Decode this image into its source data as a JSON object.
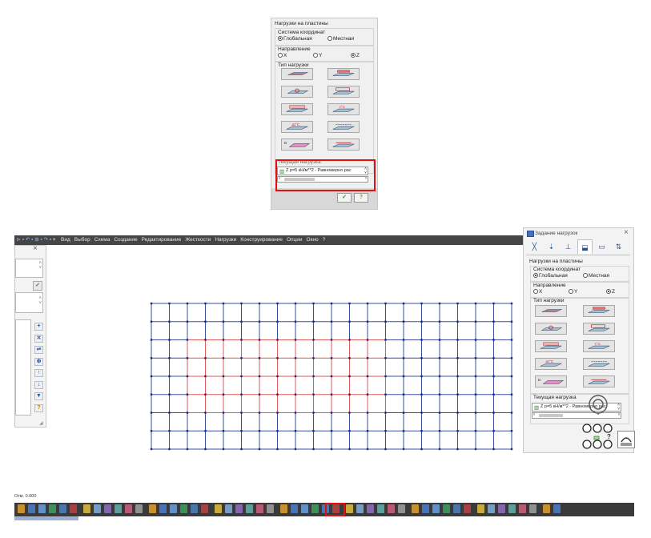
{
  "top_dialog": {
    "group_title": "Нагрузки на пластины",
    "coord_label": "Система координат",
    "coord_global": "Глобальная",
    "coord_local": "Местная",
    "direction_label": "Направление",
    "dir_x": "X",
    "dir_y": "Y",
    "dir_z": "Z",
    "load_type_label": "Тип нагрузки",
    "current_load_label": "Текущая нагрузка",
    "current_load_value": "Z p=5 кН/м**2 - Равномерно рас",
    "apply_label": "✓",
    "help_label": "?"
  },
  "menu": {
    "quick_access": "⊳ ▪ ↶ ▪ ⊞ ▪ ↷ ▪ ▾",
    "items": [
      "Вид",
      "Выбор",
      "Схема",
      "Создание",
      "Редактирование",
      "Жесткости",
      "Нагрузки",
      "Конструирование",
      "Опции",
      "Окно",
      "?"
    ]
  },
  "left_panel": {
    "close": "×",
    "apply": "✓",
    "help": "?"
  },
  "right_dialog": {
    "title": "Задание нагрузок",
    "close": "×",
    "group_title": "Нагрузки на пластины",
    "coord_label": "Система координат",
    "coord_global": "Глобальная",
    "coord_local": "Местная",
    "direction_label": "Направление",
    "dir_x": "X",
    "dir_y": "Y",
    "dir_z": "Z",
    "load_type_label": "Тип нагрузки",
    "current_load_label": "Текущая нагрузка",
    "current_load_value": "Z p=5 кН/м**2 - Равномерно рас",
    "help_label": "?"
  },
  "status": {
    "coord_text": "Отм. 0.000"
  },
  "colors": {
    "grid_blue": "#3a4fa0",
    "grid_red": "#e05a5a",
    "highlight": "#e01010",
    "menubar": "#454545"
  }
}
